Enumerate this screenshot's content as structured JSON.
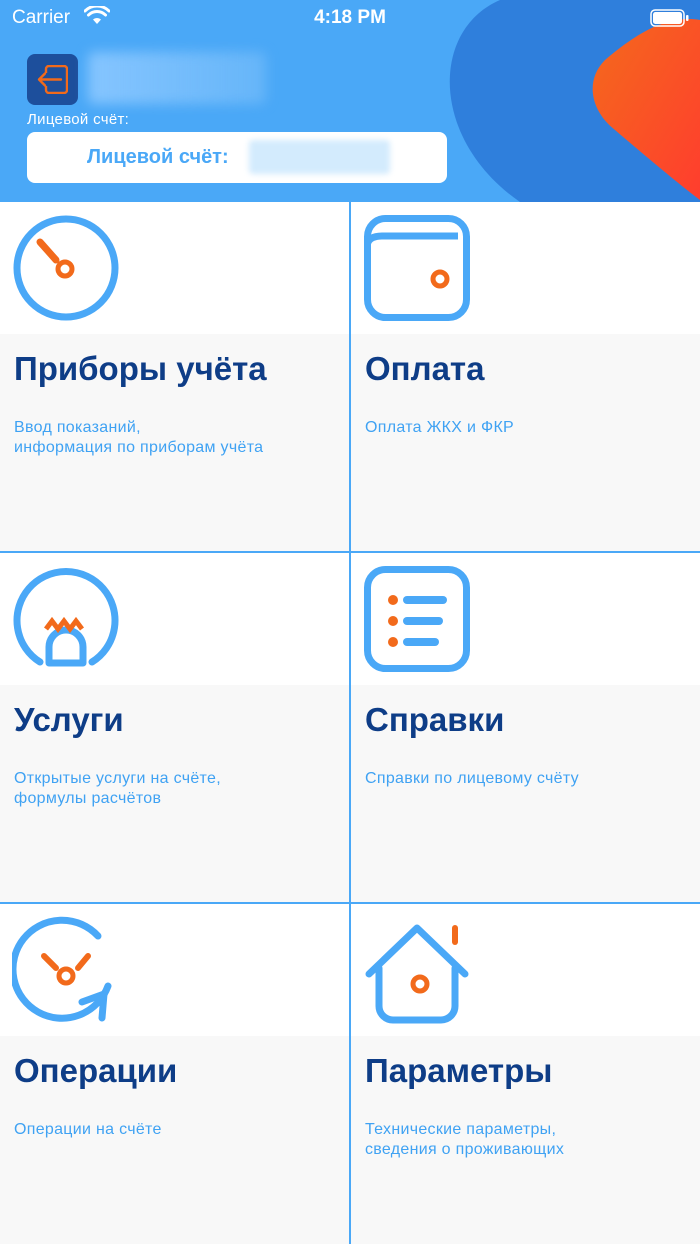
{
  "status_bar": {
    "carrier": "Carrier",
    "time": "4:18 PM"
  },
  "header": {
    "account_caption": "Лицевой счёт:",
    "account_box_label": "Лицевой счёт:"
  },
  "colors": {
    "primary_blue": "#4aa8f7",
    "dark_blue": "#0e3d87",
    "accent_orange": "#f26a1b",
    "header_dark": "#2f7fdc"
  },
  "tiles": [
    {
      "icon": "meter-gauge-icon",
      "title": "Приборы учёта",
      "description": "Ввод показаний,\nинформация по приборам учёта"
    },
    {
      "icon": "wallet-icon",
      "title": "Оплата",
      "description": "Оплата ЖКХ и ФКР"
    },
    {
      "icon": "lightbulb-icon",
      "title": "Услуги",
      "description": "Открытые услуги на счёте,\nформулы расчётов"
    },
    {
      "icon": "list-document-icon",
      "title": "Справки",
      "description": "Справки по лицевому счёту"
    },
    {
      "icon": "refresh-clock-icon",
      "title": "Операции",
      "description": "Операции на счёте"
    },
    {
      "icon": "house-icon",
      "title": "Параметры",
      "description": "Технические параметры,\nсведения о проживающих"
    }
  ]
}
